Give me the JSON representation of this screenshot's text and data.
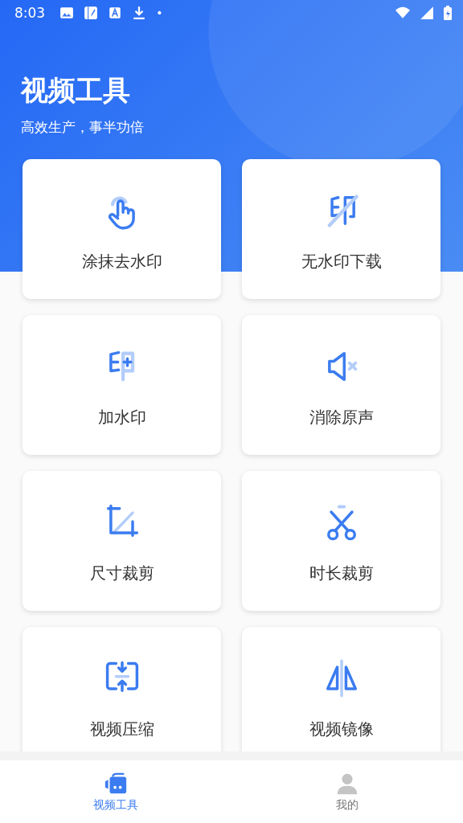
{
  "status_bar": {
    "time": "8:03",
    "dot": "•"
  },
  "header": {
    "title": "视频工具",
    "subtitle": "高效生产，事半功倍"
  },
  "tools": [
    {
      "kind": "smear",
      "label": "涂抹去水印"
    },
    {
      "kind": "nomark",
      "label": "无水印下载"
    },
    {
      "kind": "addmark",
      "label": "加水印"
    },
    {
      "kind": "mute",
      "label": "消除原声"
    },
    {
      "kind": "crop",
      "label": "尺寸裁剪"
    },
    {
      "kind": "cut",
      "label": "时长裁剪"
    },
    {
      "kind": "compress",
      "label": "视频压缩"
    },
    {
      "kind": "mirror",
      "label": "视频镜像"
    }
  ],
  "bottom_nav": [
    {
      "kind": "camera",
      "label": "视频工具",
      "selected": true
    },
    {
      "kind": "person",
      "label": "我的",
      "selected": false
    }
  ]
}
